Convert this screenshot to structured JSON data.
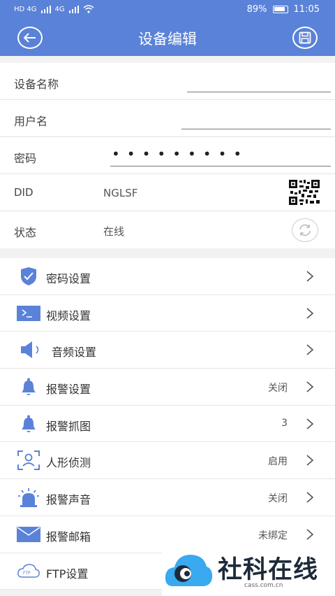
{
  "status_bar": {
    "network_1": "HD 4G",
    "network_2": "4G",
    "battery": "89%",
    "time": "11:05"
  },
  "header": {
    "title": "设备编辑"
  },
  "form": {
    "name_label": "设备名称",
    "user_label": "用户名",
    "password_label": "密码",
    "password_mask": "•••••••••",
    "did_label": "DID",
    "did_value": "NGLSF",
    "state_label": "状态",
    "state_value": "在线"
  },
  "menu": [
    {
      "label": "密码设置",
      "value": "",
      "icon": "shield-check-icon"
    },
    {
      "label": "视频设置",
      "value": "",
      "icon": "terminal-icon"
    },
    {
      "label": "音频设置",
      "value": "",
      "icon": "speaker-icon"
    },
    {
      "label": "报警设置",
      "value": "关闭",
      "icon": "bell-icon"
    },
    {
      "label": "报警抓图",
      "value": "3",
      "icon": "bell-icon"
    },
    {
      "label": "人形侦测",
      "value": "启用",
      "icon": "person-frame-icon"
    },
    {
      "label": "报警声音",
      "value": "关闭",
      "icon": "siren-icon"
    },
    {
      "label": "报警邮箱",
      "value": "未绑定",
      "icon": "envelope-icon"
    },
    {
      "label": "FTP设置",
      "value": "",
      "icon": "ftp-cloud-icon"
    }
  ],
  "watermark": {
    "brand": "社科在线",
    "url": "cass.com.cn"
  },
  "colors": {
    "primary": "#5a82d8",
    "background": "#f2f2f2"
  }
}
